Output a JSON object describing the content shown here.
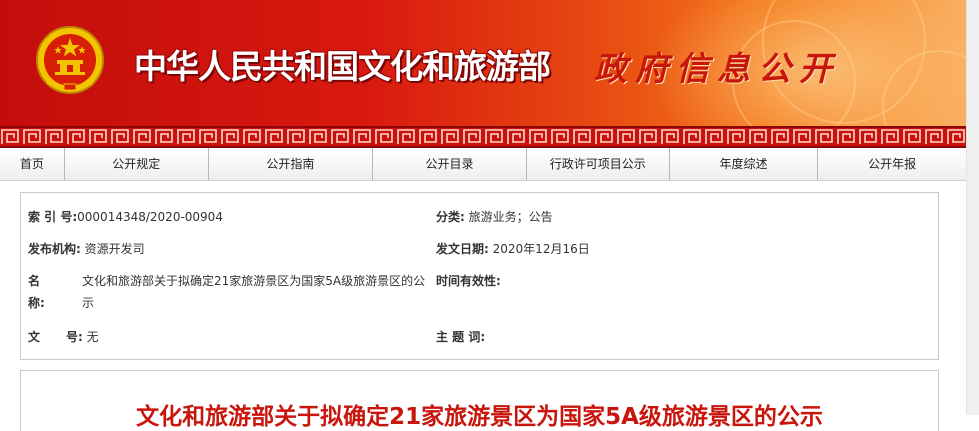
{
  "header": {
    "site_title": "中华人民共和国文化和旅游部",
    "section_title": "政府信息公开",
    "emblem": "national-emblem-icon"
  },
  "nav": {
    "items": [
      "首页",
      "公开规定",
      "公开指南",
      "公开目录",
      "行政许可项目公示",
      "年度综述",
      "公开年报"
    ]
  },
  "info": {
    "index": {
      "label": "索 引 号:",
      "value": "000014348/2020-00904"
    },
    "category": {
      "label": "分类:",
      "value": "旅游业务；公告"
    },
    "org": {
      "label": "发布机构:",
      "value": "资源开发司"
    },
    "date": {
      "label": "发文日期:",
      "value": "2020年12月16日"
    },
    "name": {
      "label_a": "名",
      "label_b": "称:",
      "value": "文化和旅游部关于拟确定21家旅游景区为国家5A级旅游景区的公示"
    },
    "validity": {
      "label": "时间有效性:",
      "value": ""
    },
    "doc_no": {
      "label_a": "文",
      "label_b": "号:",
      "value": "无"
    },
    "subject": {
      "label": "主 题 词:",
      "value": ""
    }
  },
  "article": {
    "title": "文化和旅游部关于拟确定21家旅游景区为国家5A级旅游景区的公示"
  },
  "colors": {
    "banner_red": "#c40d0b",
    "banner_orange": "#f47a1c",
    "title_red": "#c8160d"
  }
}
